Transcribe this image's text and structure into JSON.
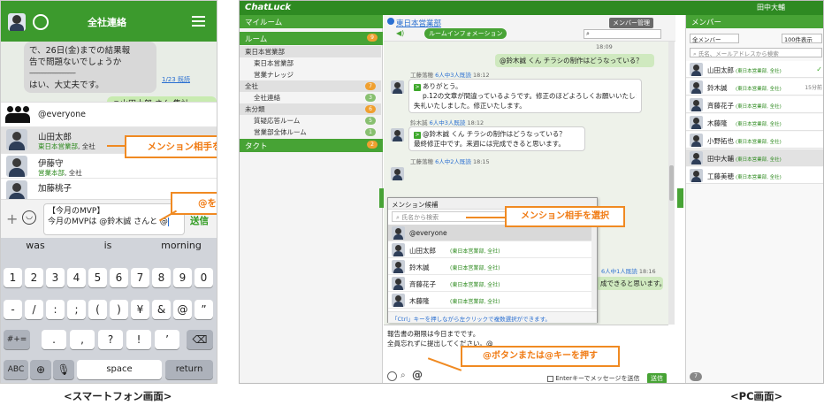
{
  "phone": {
    "title": "全社連絡",
    "bubble_lines": [
      "で、26日(金)までの結果報",
      "告で問題ないでしょうか",
      "----------------------------------",
      "はい、大丈夫です。"
    ],
    "read_link": "1/23 既読",
    "mine_snip": "@山田太郎 さん 集計",
    "mentions": [
      {
        "name": "@everyone",
        "dept": "",
        "suffix": ""
      },
      {
        "name": "山田太郎",
        "dept": "東日本営業部",
        "suffix": ", 全社"
      },
      {
        "name": "伊藤守",
        "dept": "営業本部",
        "suffix": ", 全社"
      },
      {
        "name": "加藤桃子",
        "dept": "",
        "suffix": ""
      }
    ],
    "input_line1": "【今月のMVP】",
    "input_line2": "今月のMVPは @鈴木誠 さんと @",
    "send": "送信",
    "suggestions": [
      "was",
      "is",
      "morning"
    ],
    "keys_row1": [
      "1",
      "2",
      "3",
      "4",
      "5",
      "6",
      "7",
      "8",
      "9",
      "0"
    ],
    "keys_row2": [
      "-",
      "/",
      ":",
      ";",
      "(",
      ")",
      "¥",
      "&",
      "@",
      "”"
    ],
    "keys_row3_mid": [
      ".",
      ",",
      "?",
      "!",
      "’"
    ],
    "key_shift": "#+=",
    "key_abc": "ABC",
    "key_space": "space",
    "key_return": "return",
    "callout_select": "メンション相手を選択",
    "callout_at": "@を入力"
  },
  "pc": {
    "logo": "ChatLuck",
    "user": "田中大輔",
    "left": {
      "myroom": "マイルーム",
      "room_group": "ルーム",
      "room_count": "9",
      "items": [
        {
          "label": "東日本営業部",
          "type": "sub",
          "count": ""
        },
        {
          "label": "東日本営業部",
          "type": "item",
          "count": ""
        },
        {
          "label": "営業ナレッジ",
          "type": "item",
          "count": ""
        },
        {
          "label": "全社",
          "type": "sub",
          "count": "7"
        },
        {
          "label": "全社連絡",
          "type": "item",
          "count": "3"
        },
        {
          "label": "未分類",
          "type": "sub",
          "count": "6"
        },
        {
          "label": "質疑応答ルーム",
          "type": "item",
          "count": "5"
        },
        {
          "label": "営業部全体ルーム",
          "type": "item",
          "count": "1"
        }
      ],
      "contact": "タクト",
      "contact_count": "2"
    },
    "chat": {
      "room": "東日本営業部",
      "manage": "メンバー管理",
      "info": "ルームインフォメーション",
      "time_top": "18:09",
      "mine_msg": "@鈴木誠 くん チラシの制作はどうなっている？",
      "msg1_meta": "工藤落穂",
      "msg1_read": "6人中3人既読",
      "msg1_time": "18:12",
      "msg1_lines": [
        "ありがとう。",
        "p.12の文章が間違っているようです。修正のほどよろしくお願いいたします。",
        "失礼いたしました。修正いたします。"
      ],
      "msg2_meta": "鈴木誠",
      "msg2_read": "6人中3人既読",
      "msg2_time": "18:12",
      "msg2_lines": [
        "@鈴木誠 くん チラシの制作はどうなっている？",
        "最終修正中です。来週には完成できると思います。"
      ],
      "msg3_meta": "工藤落穂",
      "msg3_read": "6人中2人既読",
      "msg3_time": "18:15",
      "msg4_read": "6人中1人既読",
      "msg4_time": "18:16",
      "msg4_snip": "成できると思います。",
      "editor_lines": [
        "報告書の期限は今日までです。",
        "全員忘れずに提出してください。@"
      ],
      "enter_label": "Enterキーでメッセージを送信",
      "send": "送信"
    },
    "popup": {
      "title": "メンション候補",
      "search": "氏名から検索",
      "rows": [
        {
          "name": "@everyone",
          "dept": ""
        },
        {
          "name": "山田太郎",
          "dept": "(東日本営業部, 全社)"
        },
        {
          "name": "鈴木誠",
          "dept": "(東日本営業部, 全社)"
        },
        {
          "name": "斉藤花子",
          "dept": "(東日本営業部, 全社)"
        },
        {
          "name": "木藤隆",
          "dept": "(東日本営業部, 全社)"
        }
      ],
      "note": "「Ctrl」キーを押しながら左クリックで複数選択ができます。"
    },
    "right": {
      "title": "メンバー",
      "filter": "全メンバー",
      "count": "100件表示",
      "search": "氏名、メールアドレスから検索",
      "rows": [
        {
          "name": "山田太郎",
          "dept": "(東日本営業部, 全社)",
          "extra": "✓"
        },
        {
          "name": "鈴木誠",
          "dept": "(東日本営業部, 全社)",
          "extra": "15分前"
        },
        {
          "name": "斉藤花子",
          "dept": "(東日本営業部, 全社)",
          "extra": ""
        },
        {
          "name": "木藤隆",
          "dept": "(東日本営業部, 全社)",
          "extra": ""
        },
        {
          "name": "小野拓也",
          "dept": "(東日本営業部, 全社)",
          "extra": ""
        },
        {
          "name": "田中大輔",
          "dept": "(東日本営業部, 全社)",
          "extra": ""
        },
        {
          "name": "工藤美穂",
          "dept": "(東日本営業部, 全社)",
          "extra": ""
        }
      ],
      "bottom_count": "7"
    },
    "callout_select": "メンション相手を選択",
    "callout_at": "@ボタンまたは@キーを押す"
  },
  "captions": {
    "phone": "<スマートフォン画面>",
    "pc": "<PC画面>"
  }
}
